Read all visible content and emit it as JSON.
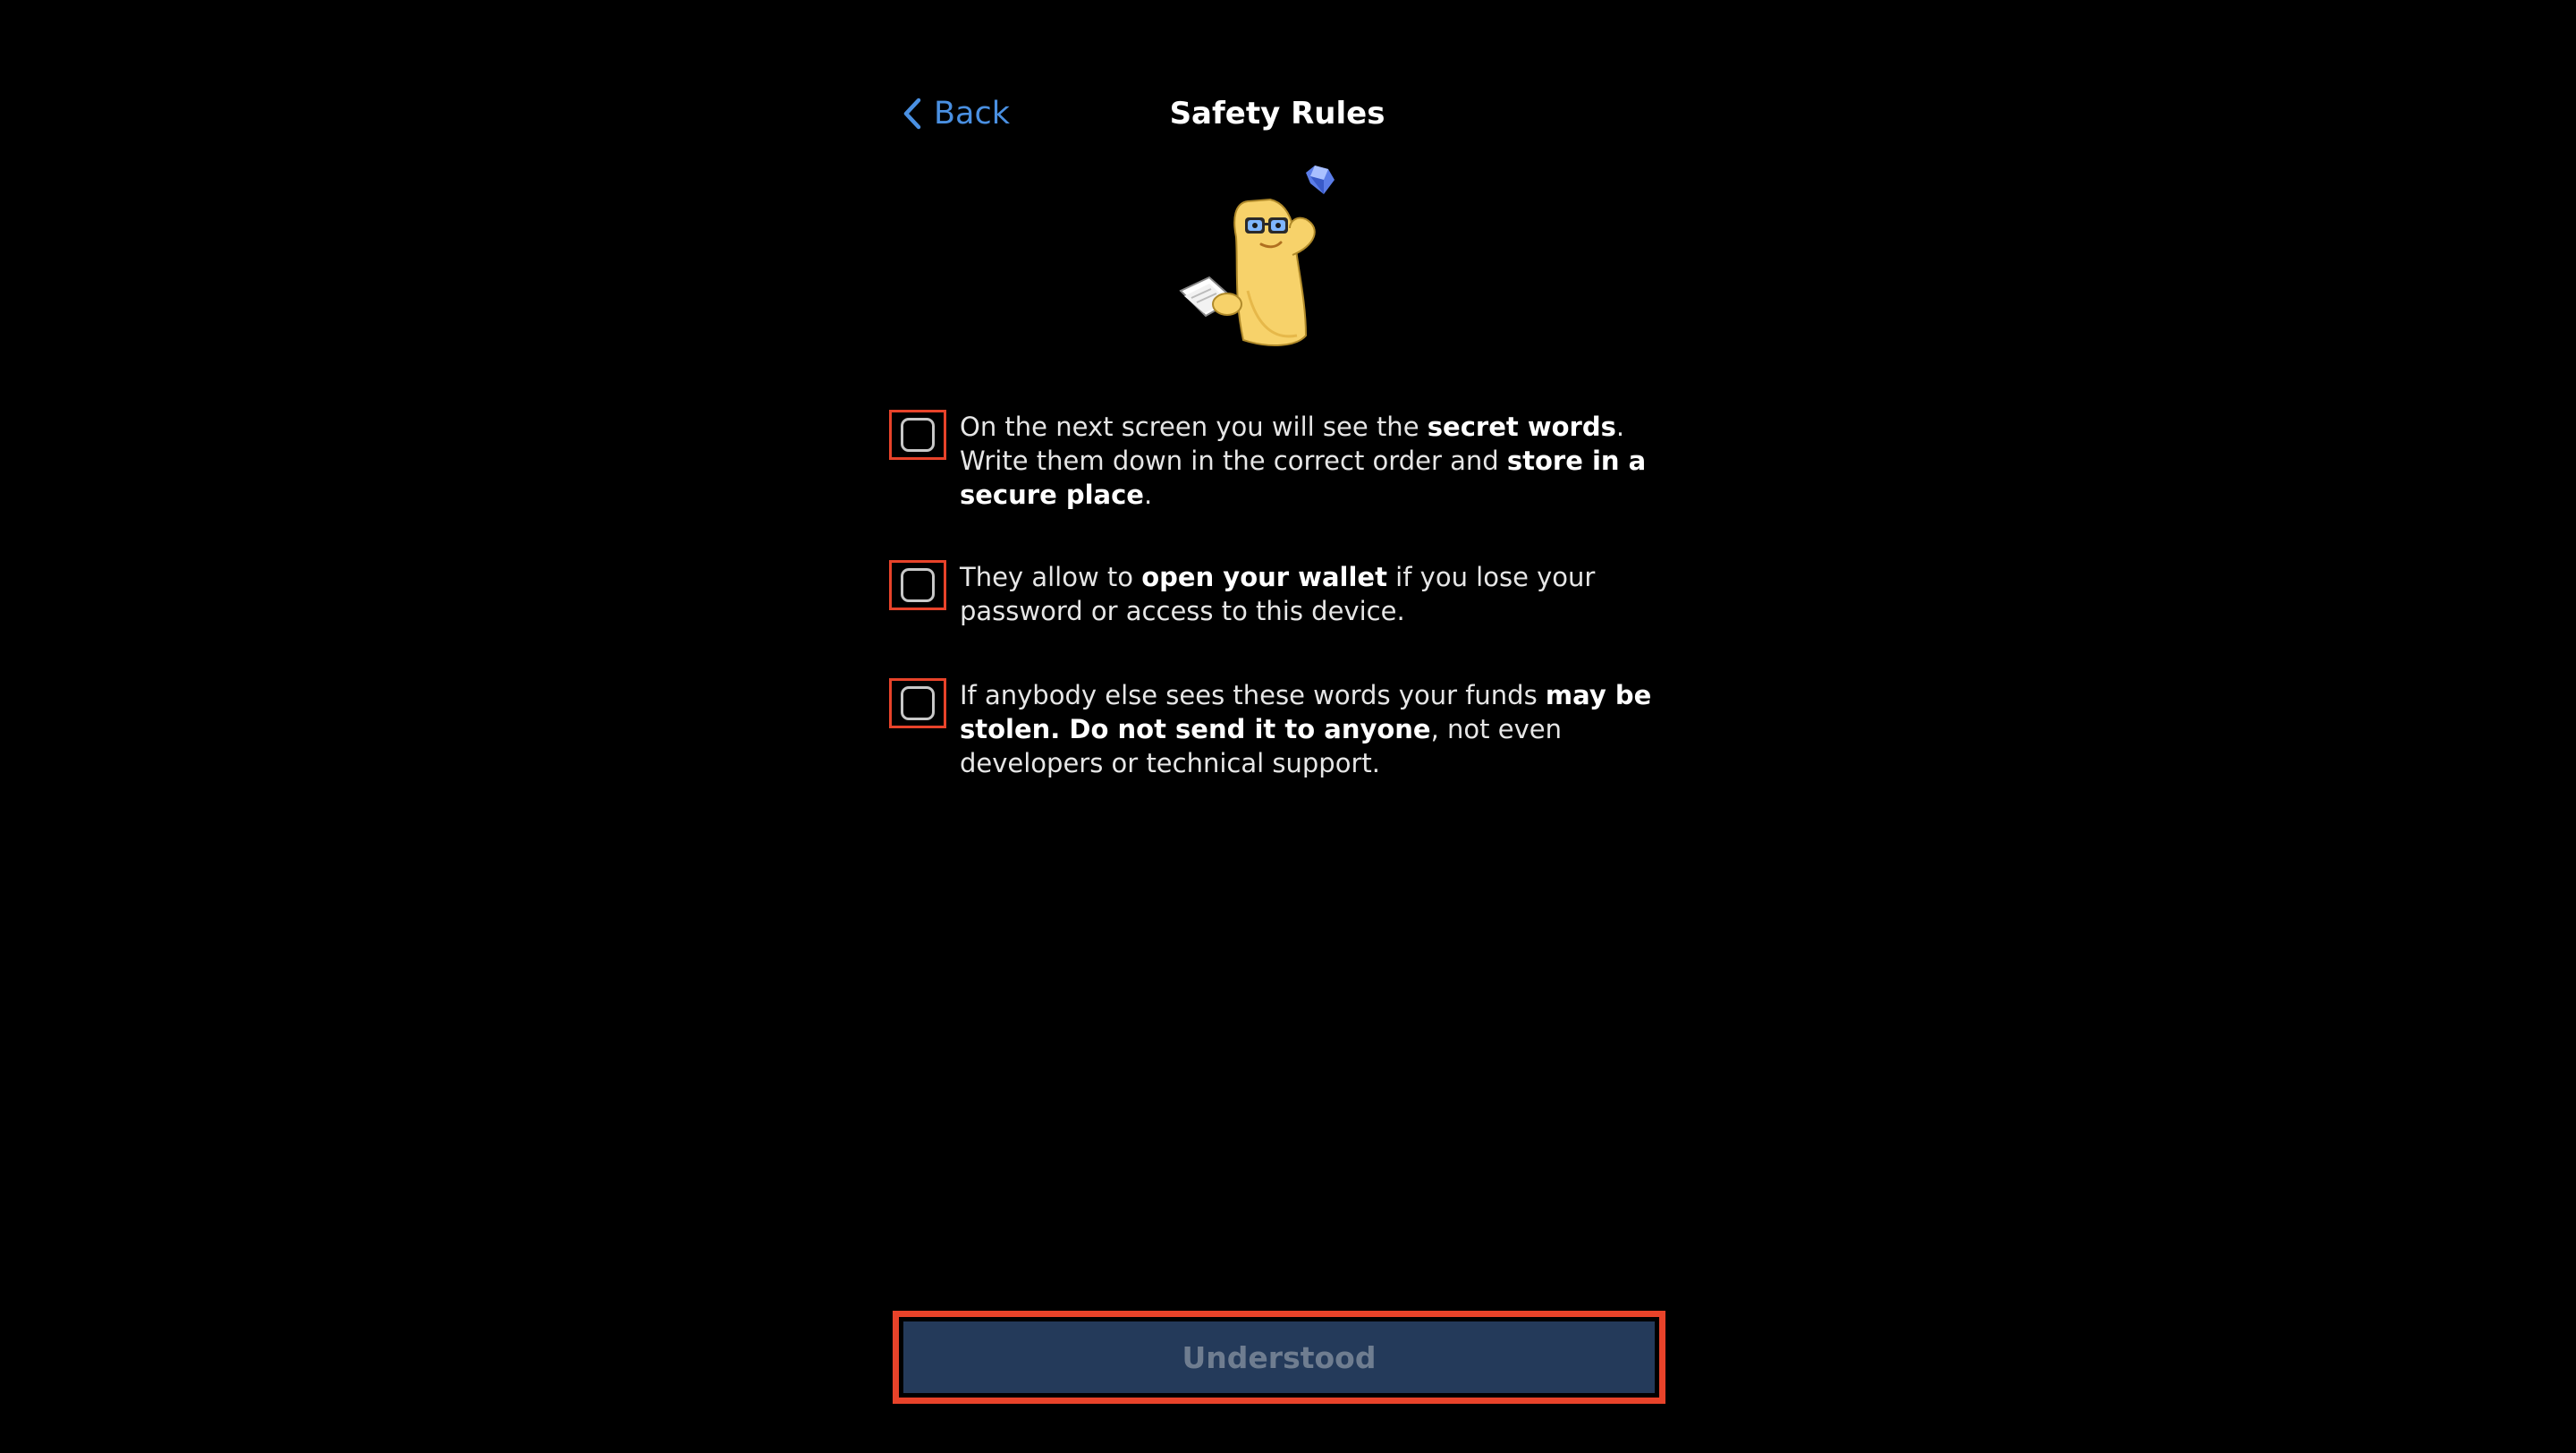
{
  "header": {
    "back_label": "Back",
    "title": "Safety Rules"
  },
  "rules": [
    {
      "parts": [
        {
          "text": "On the next screen you will see the ",
          "bold": false
        },
        {
          "text": "secret words",
          "bold": true
        },
        {
          "text": ". Write them down in the correct order and ",
          "bold": false
        },
        {
          "text": "store in a secure place",
          "bold": true
        },
        {
          "text": ".",
          "bold": false
        }
      ],
      "checked": false
    },
    {
      "parts": [
        {
          "text": "They allow to ",
          "bold": false
        },
        {
          "text": "open your wallet",
          "bold": true
        },
        {
          "text": " if you lose your password or access to this device.",
          "bold": false
        }
      ],
      "checked": false
    },
    {
      "parts": [
        {
          "text": "If anybody else sees these words your funds ",
          "bold": false
        },
        {
          "text": "may be stolen. Do not send it to anyone",
          "bold": true
        },
        {
          "text": ", not even developers or technical support.",
          "bold": false
        }
      ],
      "checked": false
    }
  ],
  "footer": {
    "button_label": "Understood"
  },
  "colors": {
    "accent": "#4a90e2",
    "button_bg": "#243a5a",
    "button_text_disabled": "#6f7d90",
    "highlight": "#e8432a"
  },
  "icons": {
    "back": "chevron-left-icon",
    "sticker": "safety-rules-sticker"
  }
}
